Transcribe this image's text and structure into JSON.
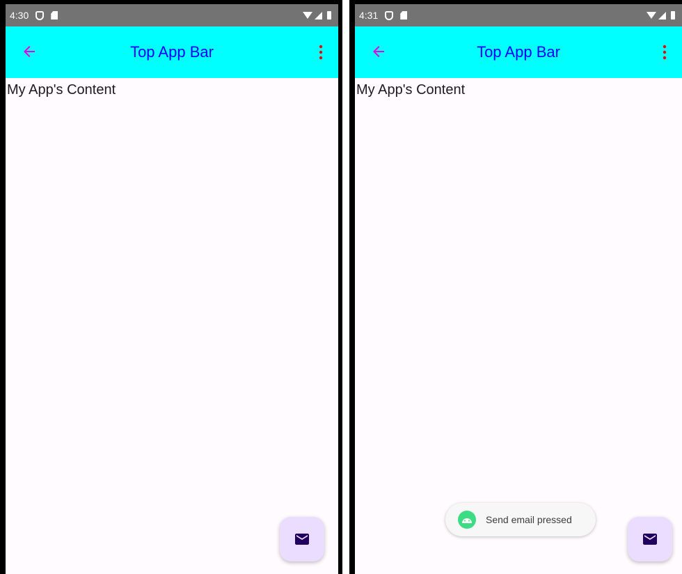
{
  "colors": {
    "appbar_bg": "#00ffff",
    "title": "#0000ff",
    "back_icon": "#e600e6",
    "menu_icon": "#ff0000",
    "fab_bg": "#eaddff",
    "fab_icon": "#21005d",
    "toast_android": "#3ddc84"
  },
  "screens": [
    {
      "status": {
        "time": "4:30"
      },
      "appbar": {
        "title": "Top App Bar",
        "back_icon": "arrow-back-icon",
        "menu_icon": "more-vert-icon"
      },
      "content": {
        "text": "My App's Content"
      },
      "fab": {
        "icon": "email-icon"
      }
    },
    {
      "status": {
        "time": "4:31"
      },
      "appbar": {
        "title": "Top App Bar",
        "back_icon": "arrow-back-icon",
        "menu_icon": "more-vert-icon"
      },
      "content": {
        "text": "My App's Content"
      },
      "fab": {
        "icon": "email-icon"
      },
      "toast": {
        "text": "Send email pressed",
        "icon": "android-icon"
      }
    }
  ]
}
